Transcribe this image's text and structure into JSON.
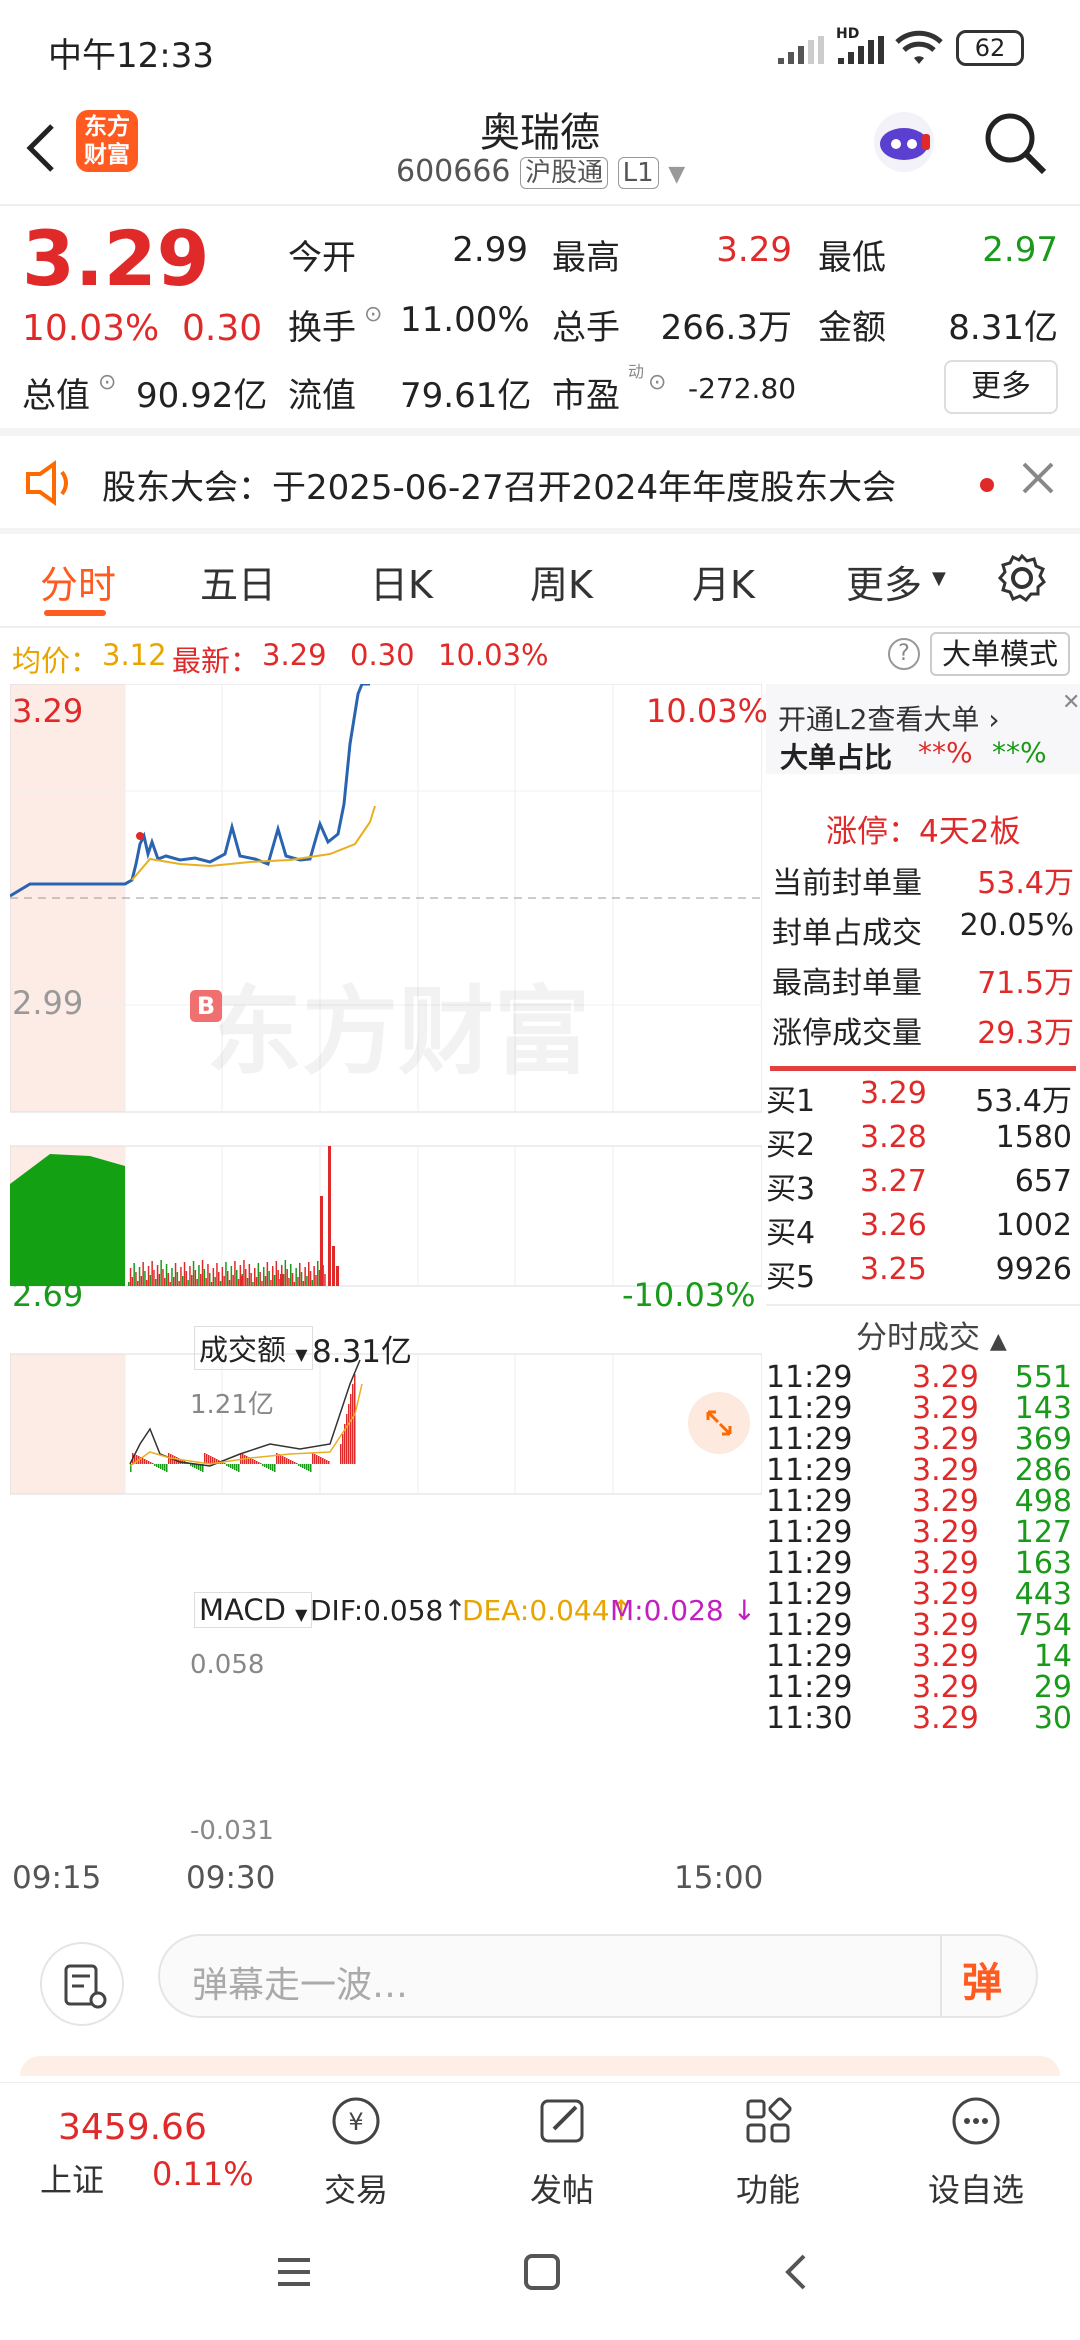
{
  "status_bar": {
    "time": "中午12:33",
    "network": "HD",
    "battery": "62"
  },
  "header": {
    "title": "奥瑞德",
    "code": "600666",
    "tag1": "沪股通",
    "tag2": "L1",
    "logo_text_line1": "东方",
    "logo_text_line2": "财富"
  },
  "quote": {
    "price": "3.29",
    "pct": "10.03%",
    "change": "0.30",
    "row1": [
      {
        "label": "今开",
        "value": "2.99",
        "color": "normal"
      },
      {
        "label": "最高",
        "value": "3.29",
        "color": "red"
      },
      {
        "label": "最低",
        "value": "2.97",
        "color": "green"
      }
    ],
    "row2": [
      {
        "label": "换手",
        "value": "11.00%"
      },
      {
        "label": "总手",
        "value": "266.3万"
      },
      {
        "label": "金额",
        "value": "8.31亿"
      }
    ],
    "row3": [
      {
        "label": "总值",
        "value": "90.92亿"
      },
      {
        "label": "流值",
        "value": "79.61亿"
      },
      {
        "label": "市盈",
        "sup": "动",
        "value": "-272.80"
      }
    ],
    "more_label": "更多"
  },
  "notice": {
    "text": "股东大会：于2025-06-27召开2024年年度股东大会"
  },
  "tabs": [
    "分时",
    "五日",
    "日K",
    "周K",
    "月K",
    "更多"
  ],
  "active_tab": "分时",
  "avg_bar": {
    "avg_label": "均价：",
    "avg_value": "3.12",
    "latest_label": "最新：",
    "latest_value": "3.29",
    "change": "0.30",
    "pct": "10.03%",
    "mode_button": "大单模式"
  },
  "chart": {
    "price_top": "3.29",
    "price_mid": "2.99",
    "price_bottom": "2.69",
    "pct_top": "10.03%",
    "pct_bottom": "-10.03%",
    "volume_selector": "成交额",
    "volume_total": "8.31亿",
    "volume_max": "1.21亿",
    "macd_selector": "MACD",
    "dif": "DIF:0.058",
    "dea": "DEA:0.044",
    "m": "M:0.028",
    "macd_top": "0.058",
    "macd_bottom": "-0.031",
    "time_start": "09:15",
    "time_open": "09:30",
    "time_end": "15:00",
    "watermark": "东方财富",
    "marker": "B"
  },
  "side": {
    "l2_link": "开通L2查看大单",
    "big_ratio_label": "大单占比",
    "big_ratio_1": "**%",
    "big_ratio_2": "**%",
    "limit_title": "涨停：4天2板",
    "limit_stats": [
      {
        "label": "当前封单量",
        "value": "53.4万",
        "red": true
      },
      {
        "label": "封单占成交",
        "value": "20.05%",
        "red": false
      },
      {
        "label": "最高封单量",
        "value": "71.5万",
        "red": true
      },
      {
        "label": "涨停成交量",
        "value": "29.3万",
        "red": true
      }
    ],
    "bids": [
      {
        "label": "买1",
        "price": "3.29",
        "vol": "53.4万"
      },
      {
        "label": "买2",
        "price": "3.28",
        "vol": "1580"
      },
      {
        "label": "买3",
        "price": "3.27",
        "vol": "657"
      },
      {
        "label": "买4",
        "price": "3.26",
        "vol": "1002"
      },
      {
        "label": "买5",
        "price": "3.25",
        "vol": "9926"
      }
    ],
    "ticks_title": "分时成交",
    "ticks": [
      {
        "t": "11:29",
        "p": "3.29",
        "v": "551"
      },
      {
        "t": "11:29",
        "p": "3.29",
        "v": "143"
      },
      {
        "t": "11:29",
        "p": "3.29",
        "v": "369"
      },
      {
        "t": "11:29",
        "p": "3.29",
        "v": "286"
      },
      {
        "t": "11:29",
        "p": "3.29",
        "v": "498"
      },
      {
        "t": "11:29",
        "p": "3.29",
        "v": "127"
      },
      {
        "t": "11:29",
        "p": "3.29",
        "v": "163"
      },
      {
        "t": "11:29",
        "p": "3.29",
        "v": "443"
      },
      {
        "t": "11:29",
        "p": "3.29",
        "v": "754"
      },
      {
        "t": "11:29",
        "p": "3.29",
        "v": "14"
      },
      {
        "t": "11:29",
        "p": "3.29",
        "v": "29"
      },
      {
        "t": "11:30",
        "p": "3.29",
        "v": "30"
      }
    ]
  },
  "input": {
    "placeholder": "弹幕走一波…",
    "danmu_button": "弹"
  },
  "bottom_nav": {
    "index_value": "3459.66",
    "index_name": "上证",
    "index_pct": "0.11%",
    "items": [
      "交易",
      "发帖",
      "功能",
      "设自选"
    ]
  },
  "colors": {
    "up": "#e02a2a",
    "down": "#1a9a1a",
    "accent": "#ff6a00",
    "price_line": "#2a64b0",
    "avg_line": "#e8b020"
  }
}
